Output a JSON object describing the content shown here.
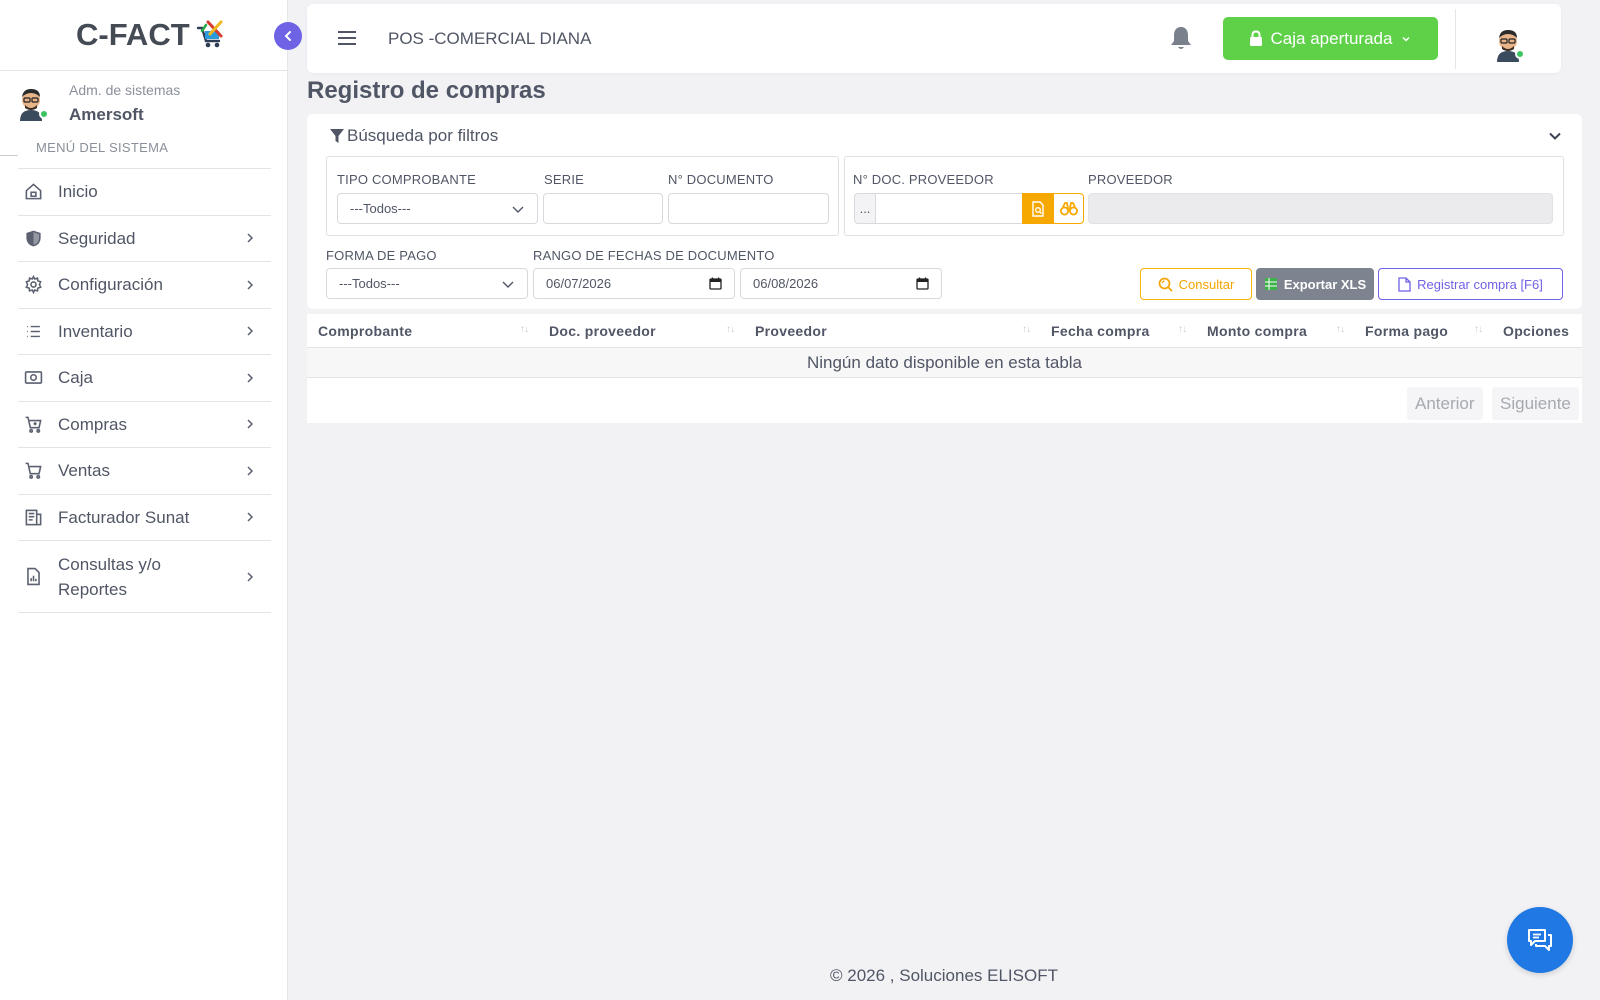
{
  "app": {
    "logo_text": "C-FACT",
    "store_name": "POS -COMERCIAL DIANA",
    "caja_status": "Caja aperturada"
  },
  "user": {
    "role": "Adm. de sistemas",
    "name": "Amersoft"
  },
  "sidebar": {
    "menu_title": "MENÚ DEL SISTEMA",
    "items": [
      {
        "label": "Inicio",
        "icon": "home-icon"
      },
      {
        "label": "Seguridad",
        "icon": "shield-icon"
      },
      {
        "label": "Configuración",
        "icon": "gear-icon"
      },
      {
        "label": "Inventario",
        "icon": "list-icon"
      },
      {
        "label": "Caja",
        "icon": "cash-icon"
      },
      {
        "label": "Compras",
        "icon": "cart-plus-icon"
      },
      {
        "label": "Ventas",
        "icon": "cart-icon"
      },
      {
        "label": "Facturador Sunat",
        "icon": "invoice-icon"
      },
      {
        "label": "Consultas y/o Reportes",
        "icon": "report-icon"
      }
    ]
  },
  "page": {
    "title": "Registro de compras"
  },
  "filters": {
    "heading": "Búsqueda por filtros",
    "tipo_comprobante": {
      "label": "TIPO COMPROBANTE",
      "value": "---Todos---"
    },
    "serie": {
      "label": "SERIE",
      "value": ""
    },
    "numero_documento": {
      "label": "N° DOCUMENTO",
      "value": ""
    },
    "doc_proveedor": {
      "label": "N° DOC. PROVEEDOR",
      "prefix": "...",
      "value": ""
    },
    "proveedor": {
      "label": "PROVEEDOR",
      "value": ""
    },
    "forma_pago": {
      "label": "FORMA DE PAGO",
      "value": "---Todos---"
    },
    "rango_fechas": {
      "label": "RANGO DE FECHAS DE DOCUMENTO",
      "desde": "06/07/2026",
      "hasta": "06/08/2026"
    },
    "buttons": {
      "consultar": "Consultar",
      "exportar": "Exportar XLS",
      "registrar": "Registrar compra [F6]"
    }
  },
  "table": {
    "columns": [
      "Comprobante",
      "Doc. proveedor",
      "Proveedor",
      "Fecha compra",
      "Monto compra",
      "Forma pago",
      "Opciones"
    ],
    "empty_message": "Ningún dato disponible en esta tabla",
    "pager": {
      "prev": "Anterior",
      "next": "Siguiente"
    }
  },
  "footer": {
    "text": "© 2026 , Soluciones ELISOFT"
  },
  "colors": {
    "primary": "#6e62e5",
    "success": "#5fd149",
    "warning": "#f4b400",
    "chat": "#1f78e3"
  }
}
